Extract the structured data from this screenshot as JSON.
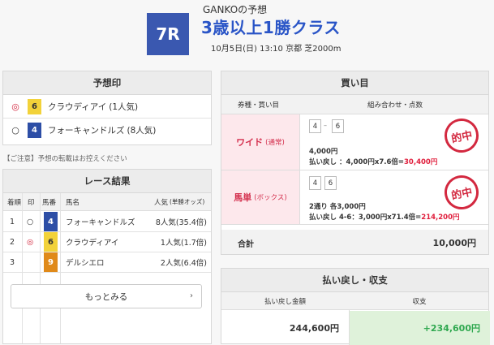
{
  "header": {
    "predictor": "GANKOの予想",
    "race_no": "7R",
    "race_title": "3歳以上1勝クラス",
    "race_meta": "10月5日(日) 13:10 京都 芝2000m"
  },
  "prediction": {
    "title": "予想印",
    "marks": [
      {
        "mark": "◎",
        "number": "6",
        "horse": "クラウディアイ",
        "pop": "(1人気)",
        "color": "yellow"
      },
      {
        "mark": "○",
        "number": "4",
        "horse": "フォーキャンドルズ",
        "pop": "(8人気)",
        "color": "blue"
      }
    ],
    "note": "【ご注意】予想の転載はお控えください"
  },
  "results": {
    "title": "レース結果",
    "headers": {
      "rank": "着順",
      "mark": "印",
      "number": "馬番",
      "horse": "馬名",
      "pop": "人気",
      "odds_note": "(単勝オッズ)"
    },
    "rows": [
      {
        "rank": "1",
        "mark": "○",
        "number": "4",
        "horse": "フォーキャンドルズ",
        "pop": "8人気(35.4倍)",
        "color": "blue"
      },
      {
        "rank": "2",
        "mark": "◎",
        "number": "6",
        "horse": "クラウディアイ",
        "pop": "1人気(1.7倍)",
        "color": "yellow"
      },
      {
        "rank": "3",
        "mark": "",
        "number": "9",
        "horse": "デルシエロ",
        "pop": "2人気(6.4倍)",
        "color": "orange"
      }
    ],
    "more_label": "もっとみる",
    "more_icon": "chevron-right-icon"
  },
  "bets": {
    "title": "買い目",
    "col_type": "券種・買い目",
    "col_combo": "組み合わせ・点数",
    "rows": [
      {
        "type": "ワイド",
        "sub": "(通常)",
        "combo": [
          "4",
          "6"
        ],
        "amount": "4,000円",
        "payout_prefix": "払い戻し ：4,000円x7.6倍=",
        "payout_value": "30,400円",
        "stamp": "的中"
      },
      {
        "type": "馬単",
        "sub": "(ボックス)",
        "combo": [
          "4",
          "6"
        ],
        "amount": "2通り 各3,000円",
        "payout_prefix": "払い戻し 4-6：3,000円x71.4倍=",
        "payout_value": "214,200円",
        "stamp": "的中"
      }
    ],
    "total_label": "合計",
    "total_value": "10,000円"
  },
  "payout": {
    "title": "払い戻し・収支",
    "col_payout": "払い戻し金額",
    "col_balance": "収支",
    "payout_value": "244,600円",
    "balance_value": "+234,600円"
  },
  "colors": {
    "accent_blue": "#2a55c7",
    "badge_blue": "#3a58b0",
    "hit_red": "#e01e3c",
    "bet_pink": "#fde8ec",
    "gain_green": "#2fa84f"
  }
}
